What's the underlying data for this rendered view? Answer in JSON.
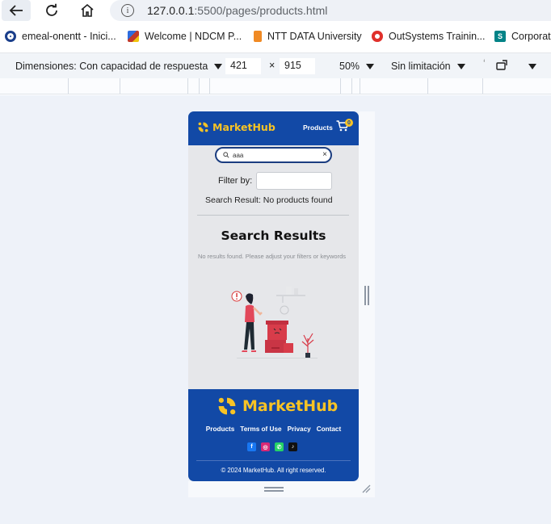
{
  "browser": {
    "url_host": "127.0.0.1",
    "url_path": ":5500/pages/products.html"
  },
  "bookmarks": [
    {
      "label": "emeal-onentt - Inici...",
      "color": "#1b3f8b"
    },
    {
      "label": "Welcome | NDCM P...",
      "color": "#c0392b"
    },
    {
      "label": "NTT DATA University",
      "color": "#f08a24"
    },
    {
      "label": "OutSystems Trainin...",
      "color": "#e0302b"
    },
    {
      "label": "Corporat",
      "color": "#038387"
    }
  ],
  "devtools": {
    "dimensions_label": "Dimensiones: Con capacidad de respuesta",
    "width": "421",
    "times": "×",
    "height": "915",
    "zoom": "50%",
    "throttle": "Sin limitación"
  },
  "app": {
    "brand": "MarketHub",
    "nav_products": "Products",
    "cart_count": "0",
    "search_value": "aaa",
    "search_clear": "×",
    "filter_label": "Filter by:",
    "result_line": "Search Result: No products found",
    "section_title": "Search Results",
    "no_results_text": "No results found. Please adjust your filters or keywords",
    "footer": {
      "brand": "MarketHub",
      "links": [
        "Products",
        "Terms of Use",
        "Privacy",
        "Contact"
      ],
      "social": [
        {
          "name": "facebook",
          "color": "#1877f2",
          "glyph": "f"
        },
        {
          "name": "instagram",
          "color": "#d62976",
          "glyph": "◎"
        },
        {
          "name": "whatsapp",
          "color": "#25d366",
          "glyph": "✆"
        },
        {
          "name": "tiktok",
          "color": "#111111",
          "glyph": "♪"
        }
      ],
      "copyright": "© 2024 MarketHub. All right reserved."
    }
  },
  "colors": {
    "brand_blue": "#1249a6",
    "brand_yellow": "#f7c325",
    "device_bg": "#e6e7ea"
  }
}
